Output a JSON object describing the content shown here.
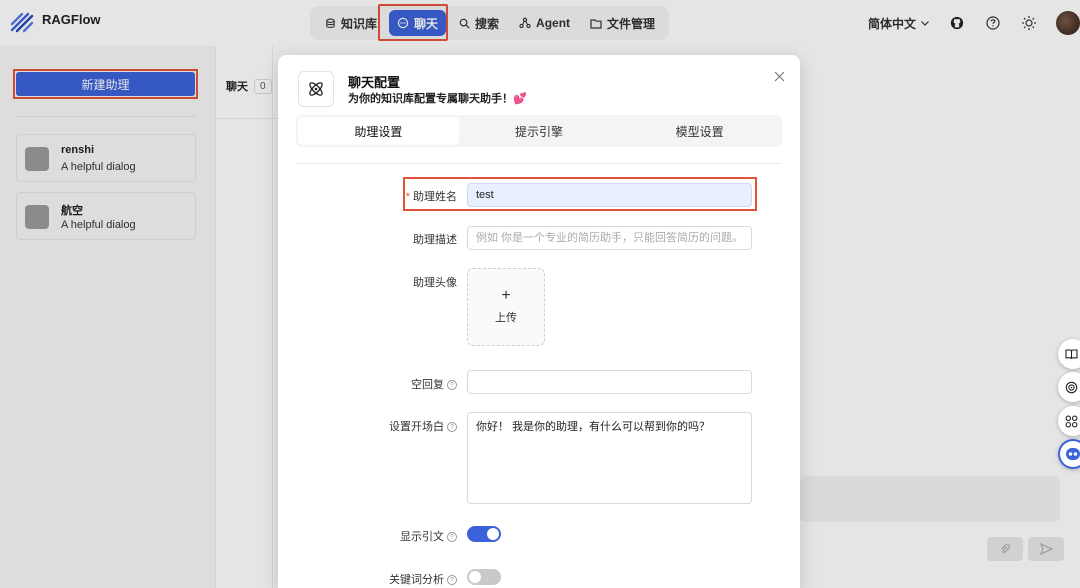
{
  "app": {
    "title": "RAGFlow"
  },
  "nav": [
    {
      "label": "知识库",
      "icon": "database-icon"
    },
    {
      "label": "聊天",
      "icon": "chat-bubble-icon",
      "active": true
    },
    {
      "label": "搜索",
      "icon": "search-icon"
    },
    {
      "label": "Agent",
      "icon": "agent-graph-icon"
    },
    {
      "label": "文件管理",
      "icon": "folder-icon"
    }
  ],
  "header_right": {
    "language": "简体中文"
  },
  "sidebar": {
    "new_button": "新建助理",
    "dialogs": [
      {
        "name": "renshi",
        "description": "A helpful dialog"
      },
      {
        "name": "航空",
        "description": "A helpful dialog"
      }
    ]
  },
  "chat": {
    "label": "聊天",
    "count": "0"
  },
  "modal": {
    "title": "聊天配置",
    "subtitle": "为你的知识库配置专属聊天助手！💕",
    "tabs": [
      "助理设置",
      "提示引擎",
      "模型设置"
    ],
    "active_tab": 0,
    "form": {
      "name_label": "助理姓名",
      "name_value": "test",
      "desc_label": "助理描述",
      "desc_placeholder": "例如 你是一个专业的简历助手，只能回答简历的问题。",
      "avatar_label": "助理头像",
      "upload_plus": "+",
      "upload_text": "上传",
      "empty_reply_label": "空回复",
      "empty_reply_value": "",
      "opener_label": "设置开场白",
      "opener_value": "你好！ 我是你的助理，有什么可以帮到你的吗？",
      "show_quote_label": "显示引文",
      "show_quote_on": true,
      "keyword_label": "关键词分析",
      "keyword_on": false
    }
  },
  "colors": {
    "accent": "#3b62d9",
    "highlight": "#e5533c"
  }
}
